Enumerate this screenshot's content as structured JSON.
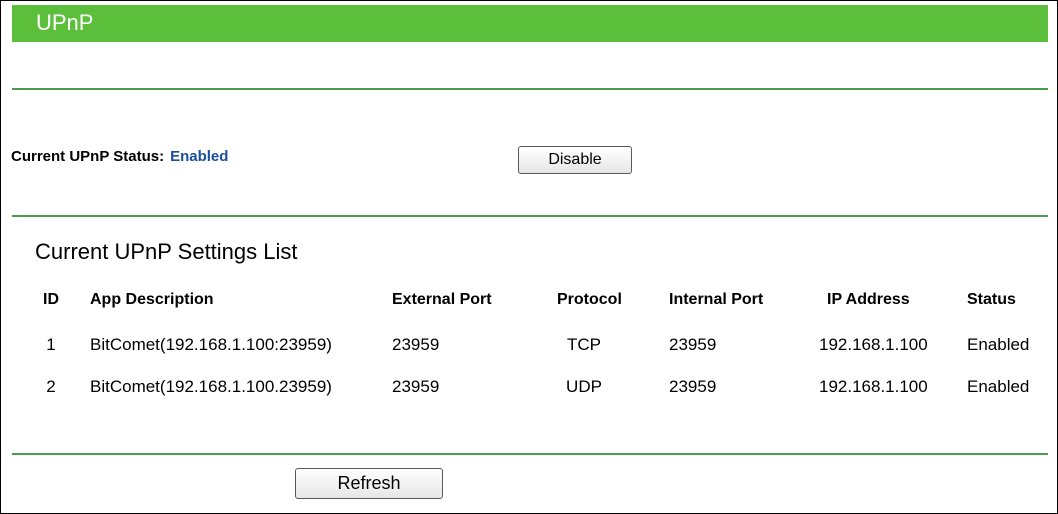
{
  "header": {
    "title": "UPnP"
  },
  "status": {
    "label": "Current UPnP Status:",
    "value": "Enabled",
    "toggle_button": "Disable"
  },
  "settings": {
    "title": "Current UPnP Settings List",
    "columns": [
      "ID",
      "App Description",
      "External Port",
      "Protocol",
      "Internal Port",
      "IP Address",
      "Status"
    ],
    "rows": [
      [
        "1",
        "BitComet(192.168.1.100:23959)",
        "23959",
        "TCP",
        "23959",
        "192.168.1.100",
        "Enabled"
      ],
      [
        "2",
        "BitComet(192.168.1.100.23959)",
        "23959",
        "UDP",
        "23959",
        "192.168.1.100",
        "Enabled"
      ]
    ]
  },
  "actions": {
    "refresh_button": "Refresh"
  },
  "colors": {
    "header_bg": "#5bbf3c",
    "divider": "#4a9c4a",
    "status_value": "#1a4fa0"
  }
}
